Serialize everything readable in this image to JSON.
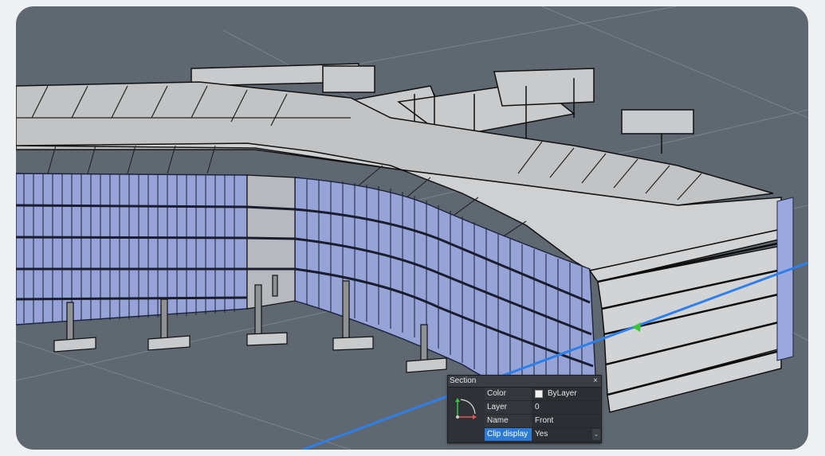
{
  "section_panel": {
    "title": "Section",
    "close_glyph": "×",
    "icon": "section-plane-icon",
    "properties": [
      {
        "key": "Color",
        "value": "ByLayer",
        "swatch": "#f2f2f2"
      },
      {
        "key": "Layer",
        "value": "0"
      },
      {
        "key": "Name",
        "value": "Front"
      },
      {
        "key": "Clip display",
        "value": "Yes",
        "selected": true,
        "dropdown_glyph": "⌄"
      }
    ]
  },
  "colors": {
    "background": "#5f6770",
    "glass": "#9aa8e0",
    "slab": "#c7c8ca",
    "section_line": "#2f7fe8",
    "selection": "#2a7ad6"
  }
}
